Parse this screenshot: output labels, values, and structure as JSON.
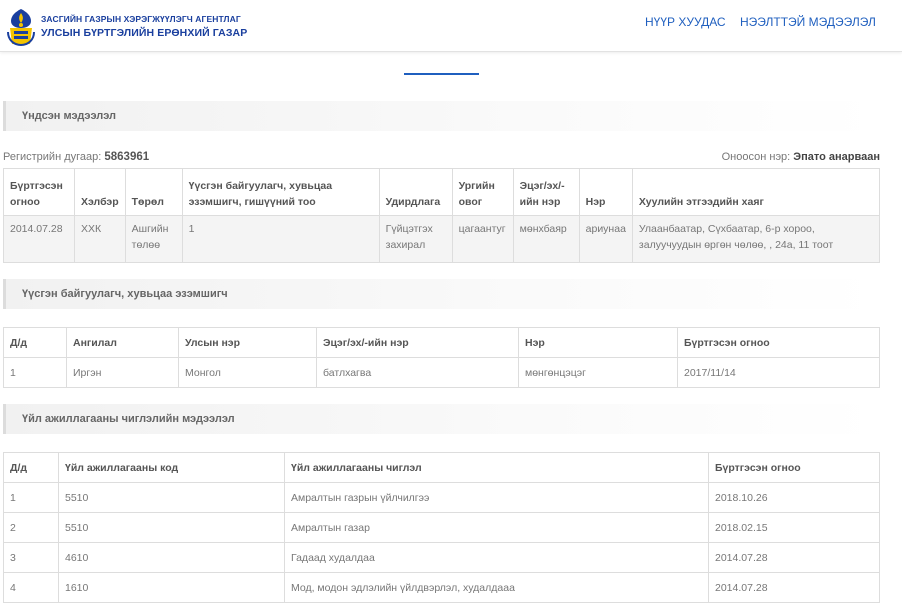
{
  "header": {
    "org_line1": "ЗАСГИЙН ГАЗРЫН ХЭРЭГЖҮҮЛЭГЧ АГЕНТЛАГ",
    "org_line2": "УЛСЫН БҮРТГЭЛИЙН ЕРӨНХИЙ ГАЗАР",
    "nav": {
      "home": "НҮҮР ХУУДАС",
      "public_info": "НЭЭЛТТЭЙ МЭДЭЭЛЭЛ"
    }
  },
  "colors": {
    "brand": "#1a3f9e",
    "accent": "#1f5fbf"
  },
  "basic": {
    "title": "Үндсэн мэдээлэл",
    "reg_label": "Регистрийн дугаар:",
    "reg_value": "5863961",
    "short_label": "Оноосон нэр:",
    "short_value": "Эпато анарваан",
    "headers": [
      "Бүртгэсэн огноо",
      "Хэлбэр",
      "Төрөл",
      "Үүсгэн байгуулагч, хувьцаа эзэмшигч, гишүүний тоо",
      "Удирдлага",
      "Ургийн овог",
      "Эцэг/эх/-ийн нэр",
      "Нэр",
      "Хуулийн этгээдийн хаяг"
    ],
    "row": [
      "2014.07.28",
      "ХХК",
      "Ашгийн төлөө",
      "1",
      "Гүйцэтгэх захирал",
      "цагаантуг",
      "мөнхбаяр",
      "ариунаа",
      "Улаанбаатар, Сүхбаатар, 6-р хороо, залуучуудын өргөн чөлөө, , 24а, 11 тоот"
    ]
  },
  "founders": {
    "title": "Үүсгэн байгуулагч, хувьцаа эзэмшигч",
    "headers": [
      "Д/д",
      "Ангилал",
      "Улсын нэр",
      "Эцэг/эх/-ийн нэр",
      "Нэр",
      "Бүртгэсэн огноо"
    ],
    "rows": [
      [
        "1",
        "Иргэн",
        "Монгол",
        "батлхагва",
        "мөнгөнцэцэг",
        "2017/11/14"
      ]
    ]
  },
  "activities": {
    "title": "Үйл ажиллагааны чиглэлийн мэдээлэл",
    "headers": [
      "Д/д",
      "Үйл ажиллагааны код",
      "Үйл ажиллагааны чиглэл",
      "Бүртгэсэн огноо"
    ],
    "rows": [
      [
        "1",
        "5510",
        "Амралтын газрын үйлчилгээ",
        "2018.10.26"
      ],
      [
        "2",
        "5510",
        "Амралтын газар",
        "2018.02.15"
      ],
      [
        "3",
        "4610",
        "Гадаад худалдаа",
        "2014.07.28"
      ],
      [
        "4",
        "1610",
        "Мод, модон эдлэлийн үйлдвэрлэл, худалдааа",
        "2014.07.28"
      ]
    ]
  }
}
